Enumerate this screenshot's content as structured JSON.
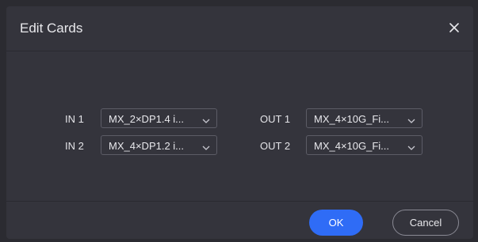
{
  "dialog": {
    "title": "Edit Cards",
    "close_icon": "close-icon"
  },
  "inputs": [
    {
      "label": "IN 1",
      "value": "MX_2×DP1.4 i..."
    },
    {
      "label": "IN 2",
      "value": "MX_4×DP1.2 i..."
    }
  ],
  "outputs": [
    {
      "label": "OUT 1",
      "value": "MX_4×10G_Fi..."
    },
    {
      "label": "OUT 2",
      "value": "MX_4×10G_Fi..."
    }
  ],
  "footer": {
    "ok_label": "OK",
    "cancel_label": "Cancel"
  },
  "colors": {
    "primary": "#2f6cf6",
    "background": "#34343c"
  }
}
